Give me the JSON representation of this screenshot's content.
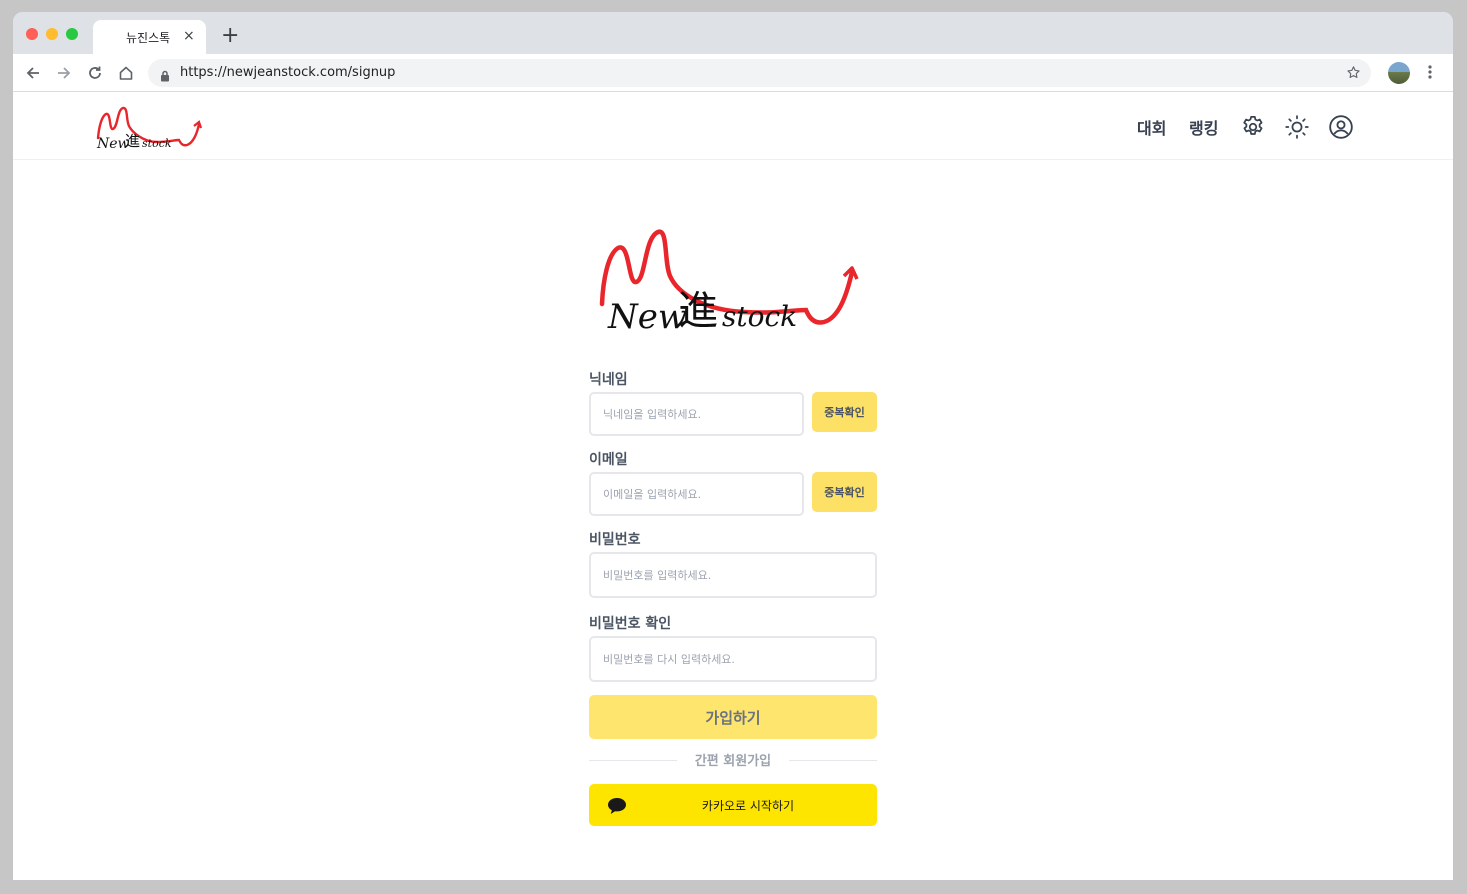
{
  "browser": {
    "tab_title": "뉴진스톡",
    "tab_close": "×",
    "new_tab": "+",
    "url": "https://newjeanstock.com/signup"
  },
  "header": {
    "nav": [
      "대회",
      "랭킹"
    ]
  },
  "form": {
    "nickname": {
      "label": "닉네임",
      "placeholder": "닉네임을 입력하세요.",
      "check_button": "중복확인"
    },
    "email": {
      "label": "이메일",
      "placeholder": "이메일을 입력하세요.",
      "check_button": "중복확인"
    },
    "password": {
      "label": "비밀번호",
      "placeholder": "비밀번호를 입력하세요."
    },
    "password_confirm": {
      "label": "비밀번호 확인",
      "placeholder": "비밀번호를 다시 입력하세요."
    },
    "submit_label": "가입하기",
    "divider_text": "간편 회원가입",
    "kakao_label": "카카오로 시작하기"
  },
  "colors": {
    "brand_red": "#e8262b",
    "accent_yellow": "#fde066",
    "kakao_yellow": "#fee500"
  },
  "icons": [
    "back-arrow-icon",
    "forward-arrow-icon",
    "reload-icon",
    "home-icon",
    "lock-icon",
    "star-icon",
    "kebab-menu-icon",
    "gear-icon",
    "sun-icon",
    "user-circle-icon",
    "chat-bubble-icon"
  ]
}
